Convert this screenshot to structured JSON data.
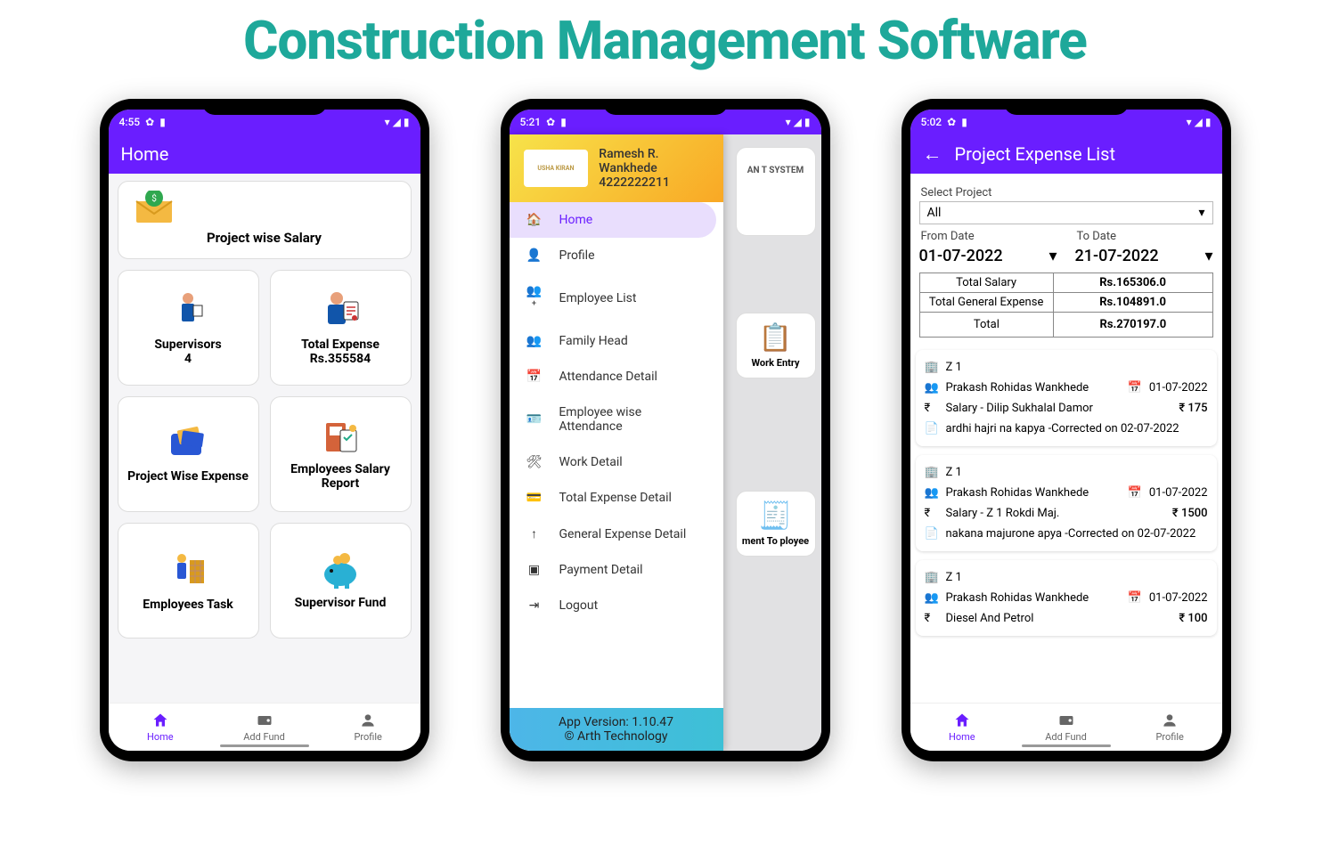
{
  "page_title": "Construction Management Software",
  "phone1": {
    "status_time": "4:55",
    "appbar_title": "Home",
    "top_card": {
      "label": "Project wise Salary"
    },
    "tiles": [
      {
        "label": "Supervisors",
        "sub": "4"
      },
      {
        "label": "Total Expense",
        "sub": "Rs.355584"
      },
      {
        "label": "Project Wise Expense",
        "sub": ""
      },
      {
        "label": "Employees Salary Report",
        "sub": ""
      },
      {
        "label": "Employees Task",
        "sub": ""
      },
      {
        "label": "Supervisor Fund",
        "sub": ""
      }
    ],
    "nav": {
      "home": "Home",
      "addfund": "Add Fund",
      "profile": "Profile"
    }
  },
  "phone2": {
    "status_time": "5:21",
    "user_name": "Ramesh R. Wankhede",
    "user_phone": "4222222211",
    "logo_text": "USHA KIRAN",
    "menu": [
      {
        "label": "Home",
        "active": true
      },
      {
        "label": "Profile"
      },
      {
        "label": "Employee List"
      },
      {
        "label": "Family Head"
      },
      {
        "label": "Attendance Detail"
      },
      {
        "label": "Employee wise Attendance"
      },
      {
        "label": "Work Detail"
      },
      {
        "label": "Total Expense Detail"
      },
      {
        "label": "General Expense Detail"
      },
      {
        "label": "Payment Detail"
      },
      {
        "label": "Logout"
      }
    ],
    "footer_version": "App Version: 1.10.47",
    "footer_copy": "© Arth Technology",
    "backdrop_cards": [
      {
        "label": "Work Entry"
      },
      {
        "label": "ment To  ployee"
      }
    ],
    "backdrop_logo": "AN T SYSTEM"
  },
  "phone3": {
    "status_time": "5:02",
    "appbar_title": "Project Expense List",
    "select_label": "Select Project",
    "select_value": "All",
    "from_label": "From Date",
    "from_value": "01-07-2022",
    "to_label": "To Date",
    "to_value": "21-07-2022",
    "summary": [
      {
        "label": "Total Salary",
        "value": "Rs.165306.0"
      },
      {
        "label": "Total General Expense",
        "value": "Rs.104891.0"
      },
      {
        "label": "Total",
        "value": "Rs.270197.0"
      }
    ],
    "items": [
      {
        "project": "Z 1",
        "person": "Prakash Rohidas Wankhede",
        "date": "01-07-2022",
        "desc": "Salary - Dilip Sukhalal Damor",
        "amount": "₹ 175",
        "note": "ardhi hajri na kapya -Corrected on 02-07-2022"
      },
      {
        "project": "Z 1",
        "person": "Prakash Rohidas Wankhede",
        "date": "01-07-2022",
        "desc": "Salary - Z 1 Rokdi Maj.",
        "amount": "₹ 1500",
        "note": "nakana majurone apya -Corrected on 02-07-2022"
      },
      {
        "project": "Z 1",
        "person": "Prakash Rohidas Wankhede",
        "date": "01-07-2022",
        "desc": "Diesel And Petrol",
        "amount": "₹ 100",
        "note": ""
      }
    ],
    "nav": {
      "home": "Home",
      "addfund": "Add Fund",
      "profile": "Profile"
    }
  }
}
